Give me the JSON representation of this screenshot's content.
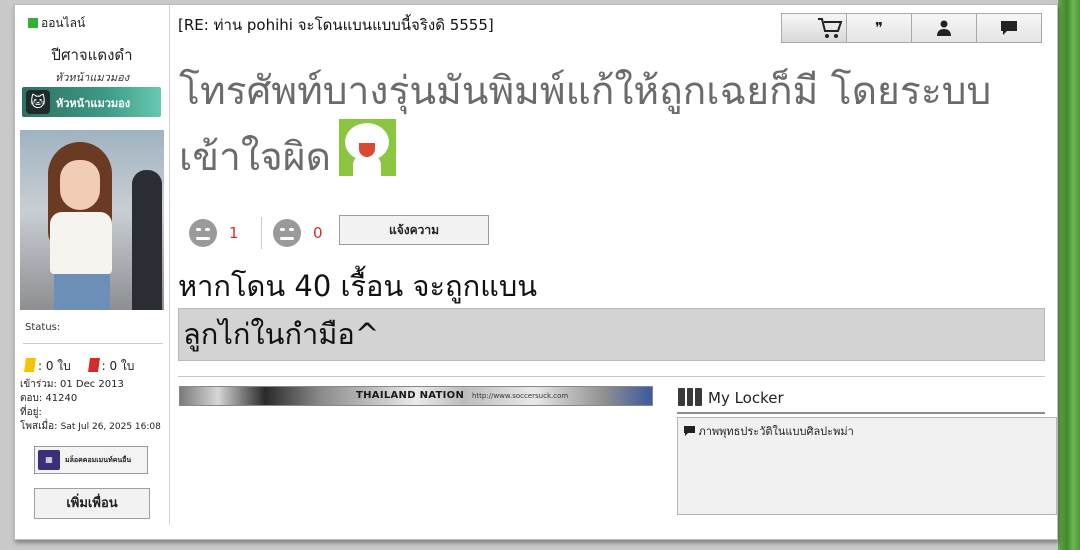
{
  "user": {
    "online_label": "ออนไลน์",
    "name": "ปีศาจแดงดำ",
    "title": "หัวหน้าแมวมอง",
    "rank_badge_text": "หัวหน้าแมวมอง",
    "status_label": "Status:",
    "yellow_cards": ": 0 ใบ",
    "red_cards": ": 0 ใบ",
    "joined": "เข้าร่วม: 01 Dec 2013",
    "replies": "ตอบ: 41240",
    "location": "ที่อยู่:",
    "posted": "โพสเมื่อ:",
    "posted_time": "Sat Jul 26, 2025 16:08",
    "vip_button": "มล็อคคอมเมนท์คนอื่น",
    "add_friend": "เพิ่มเพื่อน"
  },
  "post": {
    "subject": "[RE: ท่าน pohihi จะโดนแบนแบบนี้จริงดิ 5555]",
    "body": "โทรศัพท์บางรุ่นมันพิมพ์แก้ให้ถูกเฉยก็มี โดยระบบเข้าใจผิด",
    "react_up_count": "1",
    "react_down_count": "0",
    "report_button": "แจ้งความ"
  },
  "toolbar": {
    "buttons": [
      "cart-icon",
      "quote-icon",
      "profile-icon",
      "message-icon"
    ],
    "quote_glyph": "❞"
  },
  "signature": {
    "line1": "หากโดน 40 เรื้อน จะถูกแบน",
    "line2": "ลูกไก่ในกำมือ^",
    "banner_text": "THAILAND NATION",
    "banner_url": "http://www.soccersuck.com"
  },
  "locker": {
    "title": "My Locker",
    "item": "ภาพพุทธประวัติในแบบศิลปะพม่า"
  },
  "colors": {
    "online": "#2fb136",
    "react_count": "#c9322b",
    "sig_box": "#d3d3d3"
  }
}
